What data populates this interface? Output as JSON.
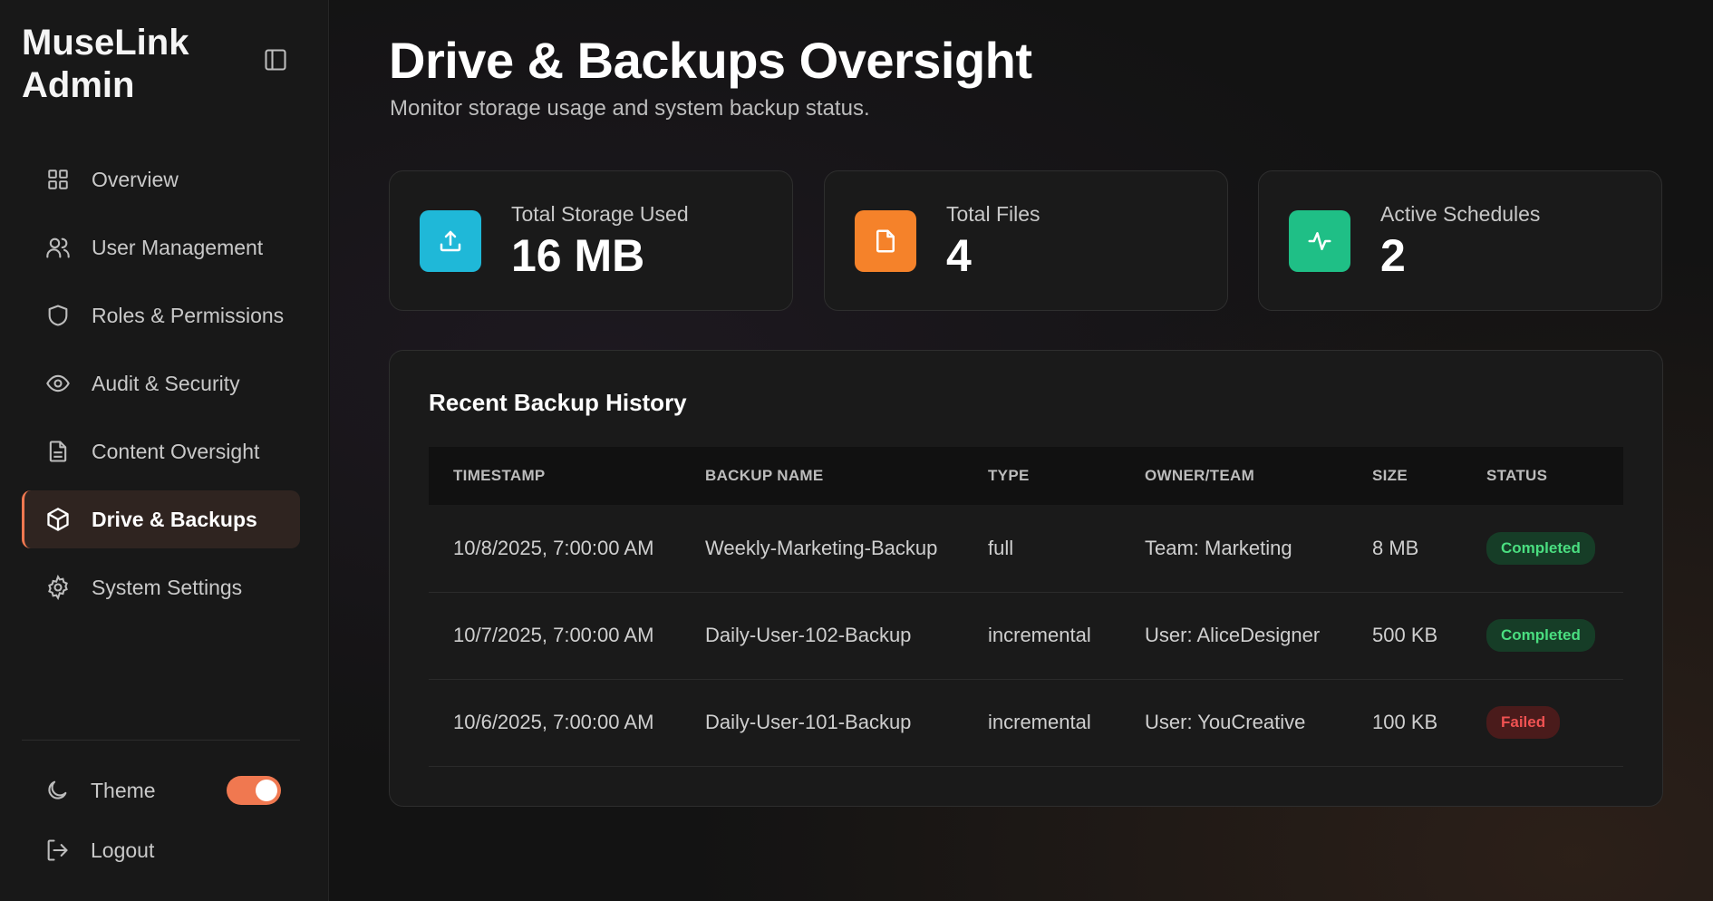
{
  "sidebar": {
    "brand": "MuseLink Admin",
    "nav": [
      {
        "label": "Overview",
        "icon": "grid-icon"
      },
      {
        "label": "User Management",
        "icon": "users-icon"
      },
      {
        "label": "Roles & Permissions",
        "icon": "shield-icon"
      },
      {
        "label": "Audit & Security",
        "icon": "eye-icon"
      },
      {
        "label": "Content Oversight",
        "icon": "file-text-icon"
      },
      {
        "label": "Drive & Backups",
        "icon": "box-icon",
        "active": true
      },
      {
        "label": "System Settings",
        "icon": "gear-icon"
      }
    ],
    "theme_label": "Theme",
    "theme_toggle_on": true,
    "logout_label": "Logout"
  },
  "header": {
    "title": "Drive & Backups Oversight",
    "subtitle": "Monitor storage usage and system backup status."
  },
  "stats": [
    {
      "label": "Total Storage Used",
      "value": "16 MB",
      "icon": "upload-icon",
      "color": "#1fb8d8"
    },
    {
      "label": "Total Files",
      "value": "4",
      "icon": "file-icon",
      "color": "#f5822a"
    },
    {
      "label": "Active Schedules",
      "value": "2",
      "icon": "activity-icon",
      "color": "#1fbf86"
    }
  ],
  "backups": {
    "title": "Recent Backup History",
    "columns": [
      "TIMESTAMP",
      "BACKUP NAME",
      "TYPE",
      "OWNER/TEAM",
      "SIZE",
      "STATUS"
    ],
    "rows": [
      {
        "timestamp": "10/8/2025, 7:00:00 AM",
        "name": "Weekly-Marketing-Backup",
        "type": "full",
        "owner": "Team: Marketing",
        "size": "8 MB",
        "status": "Completed"
      },
      {
        "timestamp": "10/7/2025, 7:00:00 AM",
        "name": "Daily-User-102-Backup",
        "type": "incremental",
        "owner": "User: AliceDesigner",
        "size": "500 KB",
        "status": "Completed"
      },
      {
        "timestamp": "10/6/2025, 7:00:00 AM",
        "name": "Daily-User-101-Backup",
        "type": "incremental",
        "owner": "User: YouCreative",
        "size": "100 KB",
        "status": "Failed"
      }
    ]
  },
  "colors": {
    "accent": "#f07850",
    "success": "#4ade80",
    "danger": "#f05252"
  }
}
